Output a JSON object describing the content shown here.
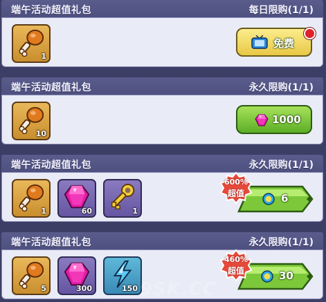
{
  "packs": [
    {
      "title": "端午活动超值礼包",
      "limit": "每日限购(1/1)",
      "items": [
        {
          "icon": "drumstick-icon",
          "qty": "1"
        }
      ],
      "button": {
        "type": "free",
        "label": "免费",
        "icon": "tv-ad-icon",
        "notification_dot": true
      }
    },
    {
      "title": "端午活动超值礼包",
      "limit": "永久限购(1/1)",
      "items": [
        {
          "icon": "drumstick-icon",
          "qty": "10"
        }
      ],
      "button": {
        "type": "gem",
        "label": "1000",
        "icon": "gem-icon"
      }
    },
    {
      "title": "端午活动超值礼包",
      "limit": "永久限购(1/1)",
      "items": [
        {
          "icon": "drumstick-icon",
          "qty": "1"
        },
        {
          "icon": "gem-icon",
          "qty": "60"
        },
        {
          "icon": "key-icon",
          "qty": "1"
        }
      ],
      "badge": {
        "percent": "600%",
        "text": "超值"
      },
      "button": {
        "type": "coin",
        "label": "6",
        "icon": "coin-icon"
      }
    },
    {
      "title": "端午活动超值礼包",
      "limit": "永久限购(1/1)",
      "items": [
        {
          "icon": "drumstick-icon",
          "qty": "5"
        },
        {
          "icon": "gem-icon",
          "qty": "300"
        },
        {
          "icon": "lightning-icon",
          "qty": "150"
        }
      ],
      "badge": {
        "percent": "460%",
        "text": "超值"
      },
      "button": {
        "type": "coin",
        "label": "30",
        "icon": "coin-icon"
      }
    }
  ],
  "watermark": "9SK.CC",
  "colors": {
    "background": "#3d3e66",
    "card": "#e9ebf6",
    "header": "#55578a",
    "free_button": "#f5de66",
    "buy_button": "#7cc83a",
    "badge": "#e64a3a"
  }
}
